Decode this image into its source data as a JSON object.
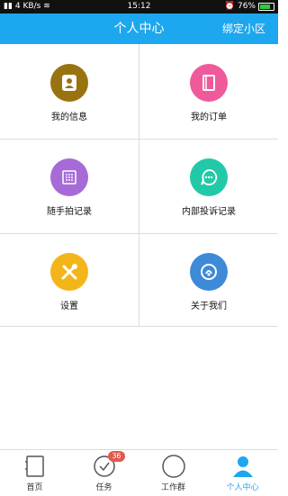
{
  "status_bar": {
    "network": "4 KB/s",
    "time": "15:12",
    "battery": "76%"
  },
  "header": {
    "title": "个人中心",
    "action": "绑定小区"
  },
  "grid": [
    {
      "label": "我的信息",
      "icon": "person-icon",
      "color": "#9a7311"
    },
    {
      "label": "我的订单",
      "icon": "document-icon",
      "color": "#ef5a9a"
    },
    {
      "label": "随手拍记录",
      "icon": "camera-grid-icon",
      "color": "#a66bd6"
    },
    {
      "label": "内部投诉记录",
      "icon": "chat-bubble-icon",
      "color": "#22c9a8"
    },
    {
      "label": "设置",
      "icon": "tools-icon",
      "color": "#f3b519"
    },
    {
      "label": "关于我们",
      "icon": "info-shield-icon",
      "color": "#3d8ad9"
    }
  ],
  "tabbar": [
    {
      "label": "首页",
      "icon": "home-icon"
    },
    {
      "label": "任务",
      "icon": "task-check-icon",
      "badge": "36"
    },
    {
      "label": "工作群",
      "icon": "group-icon"
    },
    {
      "label": "个人中心",
      "icon": "profile-icon",
      "active": true
    }
  ],
  "colors": {
    "brand": "#1da7ee",
    "badge": "#e05a4f"
  }
}
